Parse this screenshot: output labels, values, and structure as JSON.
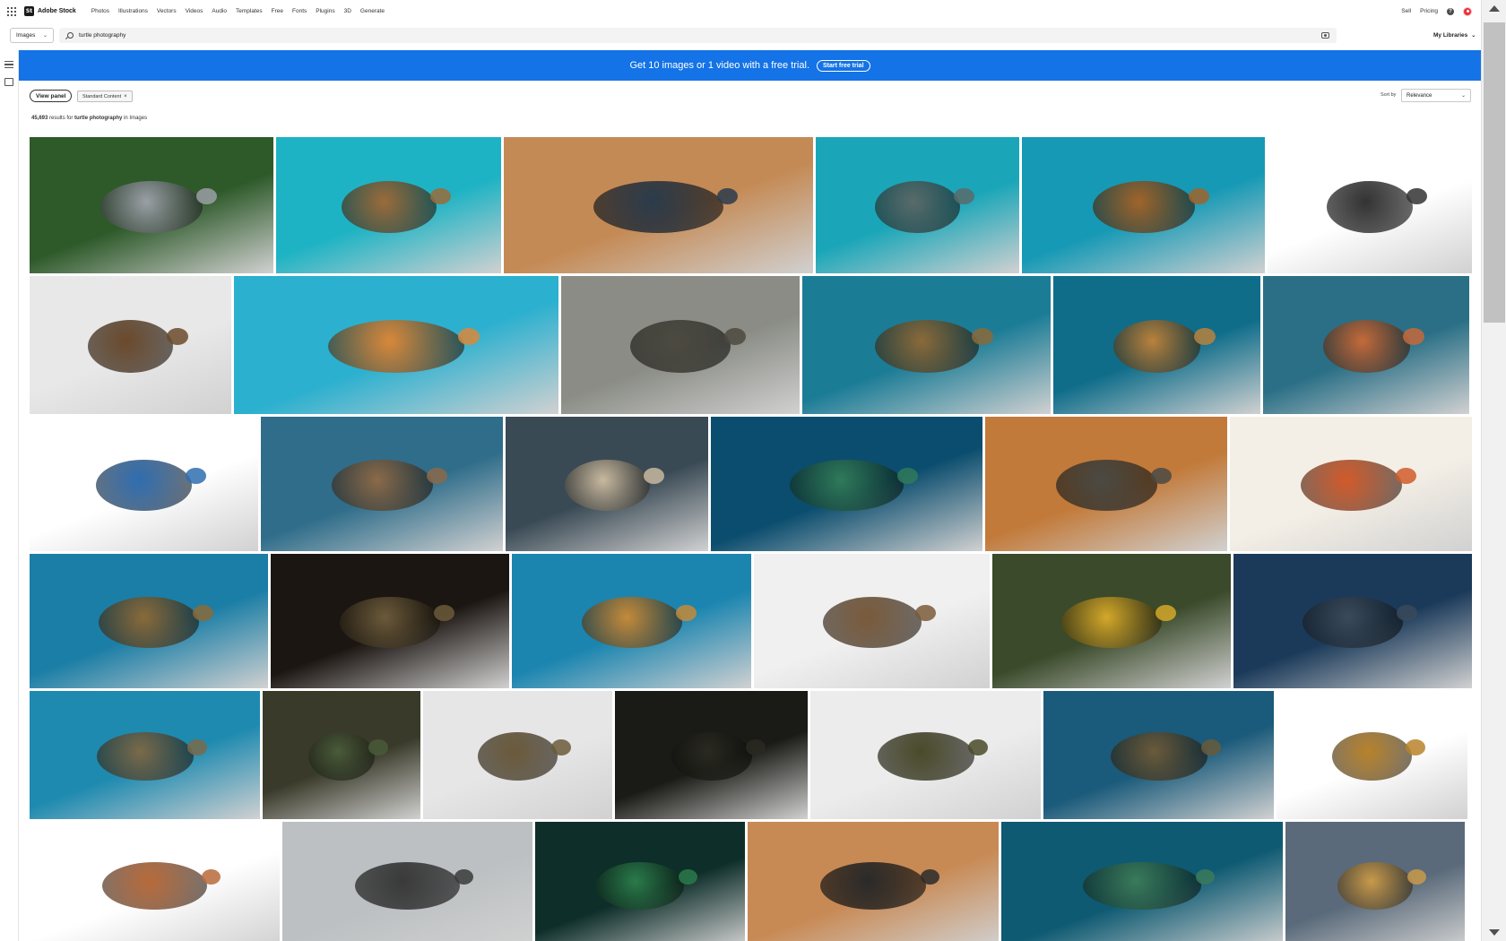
{
  "brand": {
    "badge": "St",
    "name": "Adobe Stock"
  },
  "nav": {
    "items": [
      "Photos",
      "Illustrations",
      "Vectors",
      "Videos",
      "Audio",
      "Templates",
      "Free",
      "Fonts",
      "Plugins",
      "3D",
      "Generate"
    ],
    "right": {
      "sell": "Sell",
      "pricing": "Pricing",
      "help": "?"
    }
  },
  "search": {
    "type": "Images",
    "query": "turtle photography",
    "my_libraries": "My Libraries"
  },
  "banner": {
    "text": "Get 10 images or 1 video with a free trial.",
    "button": "Start free trial",
    "color": "#1473e6"
  },
  "filters": {
    "view_panel": "View panel",
    "chip": "Standard Content",
    "sort_label": "Sort by",
    "sort_value": "Relevance"
  },
  "results": {
    "count": "45,693",
    "prefix": "results for",
    "query": "turtle photography",
    "suffix": "in Images"
  },
  "thumbnails": {
    "icons": [
      "image-thumbnail"
    ]
  }
}
